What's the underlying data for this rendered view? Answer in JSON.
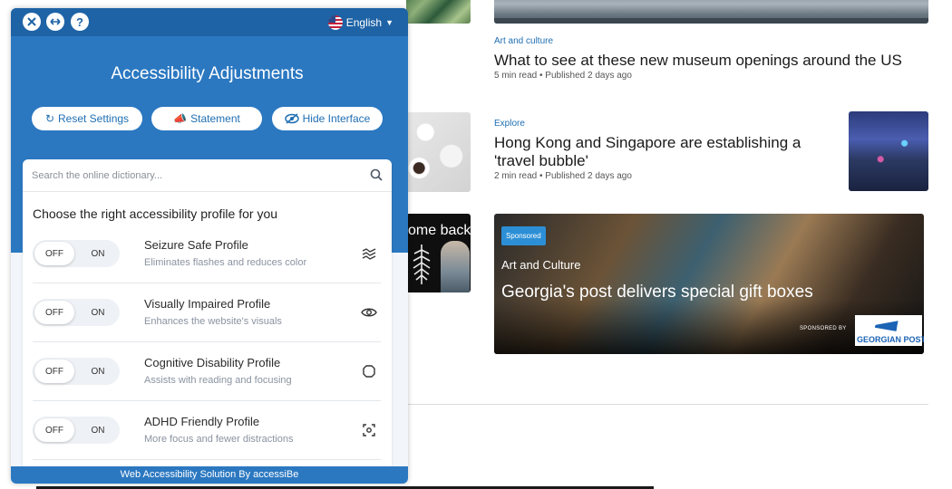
{
  "colors": {
    "panel_blue": "#2b78c1",
    "topbar_blue": "#1e63a6",
    "link_blue": "#1f6fb3",
    "sponsored_badge": "#2c8fd6"
  },
  "site": {
    "articles": [
      {
        "category": "Art and culture",
        "headline": "What to see at these new museum openings around the US",
        "meta": "5 min read • Published 2 days ago"
      },
      {
        "category": "Explore",
        "headline_line1": "Hong Kong and Singapore are establishing a",
        "headline_line2": "'travel bubble'",
        "meta": "2 min read • Published 2 days ago"
      }
    ],
    "promo_text": "ome back",
    "sponsored": {
      "badge": "Sponsored",
      "category": "Art and Culture",
      "title": "Georgia's post delivers special gift boxes",
      "sponsored_by": "SPONSORED BY",
      "logo_text": "GEORGIAN POST"
    }
  },
  "panel": {
    "language": "English",
    "title": "Accessibility Adjustments",
    "buttons": {
      "reset": "Reset Settings",
      "statement": "Statement",
      "hide": "Hide Interface"
    },
    "search_placeholder": "Search the online dictionary...",
    "choose_label": "Choose the right accessibility profile for you",
    "toggle": {
      "off": "OFF",
      "on": "ON"
    },
    "profiles": [
      {
        "name": "Seizure Safe Profile",
        "desc": "Eliminates flashes and reduces color",
        "icon": "zigzag-icon"
      },
      {
        "name": "Visually Impaired Profile",
        "desc": "Enhances the website's visuals",
        "icon": "eye-icon"
      },
      {
        "name": "Cognitive Disability Profile",
        "desc": "Assists with reading and focusing",
        "icon": "octagon-icon"
      },
      {
        "name": "ADHD Friendly Profile",
        "desc": "More focus and fewer distractions",
        "icon": "focus-icon"
      }
    ],
    "footer": "Web Accessibility Solution By accessiBe"
  }
}
